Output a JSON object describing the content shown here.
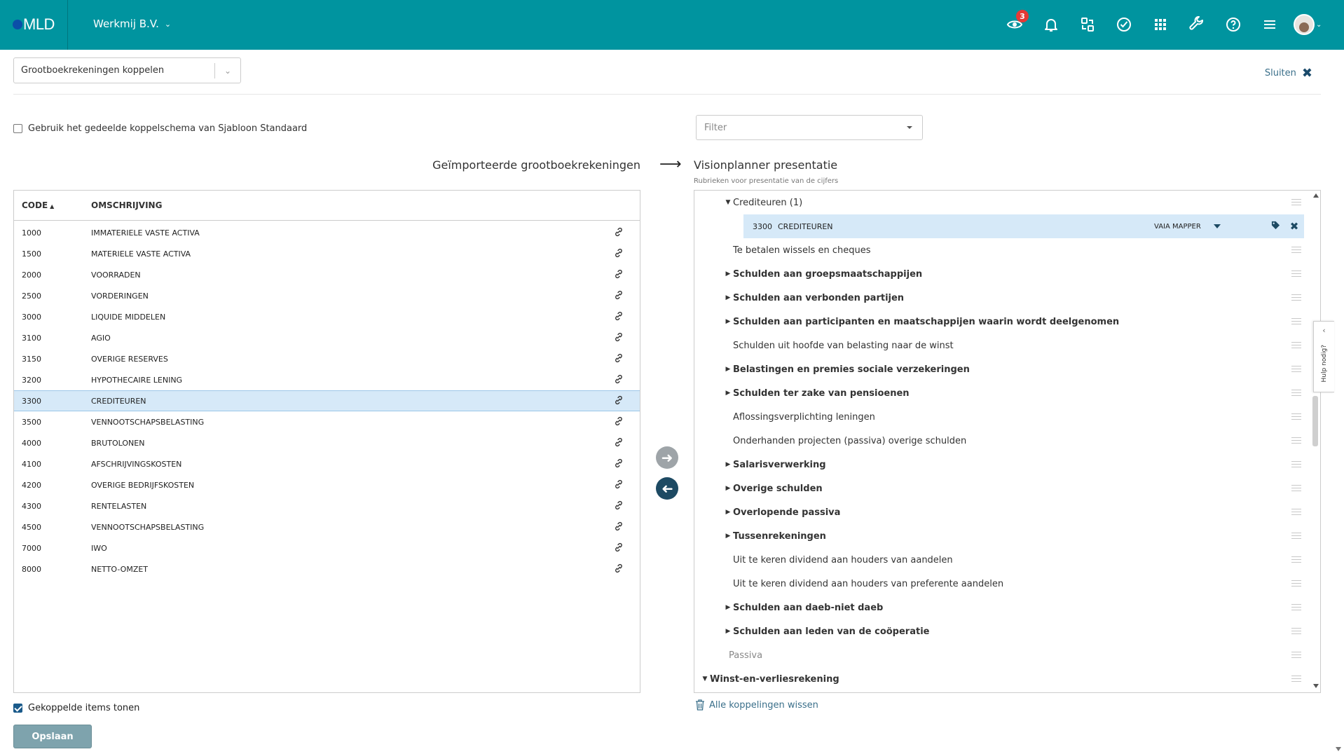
{
  "header": {
    "logo": "MLD",
    "company": "Werkmij B.V.",
    "notification_count": "3",
    "icons": [
      "visionplanner-eye-icon",
      "bell-icon",
      "transfer-icon",
      "check-circle-icon",
      "apps-grid-icon",
      "wrench-icon",
      "help-icon",
      "menu-icon"
    ],
    "accent": "#00949f"
  },
  "toolbar": {
    "mode_select": "Grootboekrekeningen koppelen",
    "close_label": "Sluiten"
  },
  "shared_schema": {
    "label": "Gebruik het gedeelde koppelschema van Sjabloon Standaard",
    "checked": false
  },
  "filter": {
    "placeholder": "Filter"
  },
  "left": {
    "title": "Geïmporteerde grootboekrekeningen",
    "columns": {
      "code": "CODE",
      "description": "OMSCHRIJVING"
    },
    "rows": [
      {
        "code": "1000",
        "desc": "IMMATERIELE VASTE ACTIVA"
      },
      {
        "code": "1500",
        "desc": "MATERIELE VASTE ACTIVA"
      },
      {
        "code": "2000",
        "desc": "VOORRADEN"
      },
      {
        "code": "2500",
        "desc": "VORDERINGEN"
      },
      {
        "code": "3000",
        "desc": "LIQUIDE MIDDELEN"
      },
      {
        "code": "3100",
        "desc": "AGIO"
      },
      {
        "code": "3150",
        "desc": "OVERIGE RESERVES"
      },
      {
        "code": "3200",
        "desc": "HYPOTHECAIRE LENING"
      },
      {
        "code": "3300",
        "desc": "CREDITEUREN"
      },
      {
        "code": "3500",
        "desc": "VENNOOTSCHAPSBELASTING"
      },
      {
        "code": "4000",
        "desc": "BRUTOLONEN"
      },
      {
        "code": "4100",
        "desc": "AFSCHRIJVINGSKOSTEN"
      },
      {
        "code": "4200",
        "desc": "OVERIGE BEDRIJFSKOSTEN"
      },
      {
        "code": "4300",
        "desc": "RENTELASTEN"
      },
      {
        "code": "4500",
        "desc": "VENNOOTSCHAPSBELASTING"
      },
      {
        "code": "7000",
        "desc": "IWO"
      },
      {
        "code": "8000",
        "desc": "NETTO-OMZET"
      }
    ],
    "selected_code": "3300"
  },
  "right": {
    "title": "Visionplanner presentatie",
    "subtitle": "Rubrieken voor presentatie van de cijfers",
    "tree": [
      {
        "label": "Crediteuren (1)",
        "bold": false,
        "state": "expanded",
        "level": 3
      },
      {
        "label": "",
        "kind": "mapped"
      },
      {
        "label": "Te betalen wissels en cheques",
        "bold": false,
        "state": "leaf",
        "level": 3
      },
      {
        "label": "Schulden aan groepsmaatschappijen",
        "bold": true,
        "state": "collapsed",
        "level": 3
      },
      {
        "label": "Schulden aan verbonden partijen",
        "bold": true,
        "state": "collapsed",
        "level": 3
      },
      {
        "label": "Schulden aan participanten en maatschappijen waarin wordt deelgenomen",
        "bold": true,
        "state": "collapsed",
        "level": 3
      },
      {
        "label": "Schulden uit hoofde van belasting naar de winst",
        "bold": false,
        "state": "leaf",
        "level": 3
      },
      {
        "label": "Belastingen en premies sociale verzekeringen",
        "bold": true,
        "state": "collapsed",
        "level": 3
      },
      {
        "label": "Schulden ter zake van pensioenen",
        "bold": true,
        "state": "collapsed",
        "level": 3
      },
      {
        "label": "Aflossingsverplichting leningen",
        "bold": false,
        "state": "leaf",
        "level": 3
      },
      {
        "label": "Onderhanden projecten (passiva) overige schulden",
        "bold": false,
        "state": "leaf",
        "level": 3
      },
      {
        "label": "Salarisverwerking",
        "bold": true,
        "state": "collapsed",
        "level": 3
      },
      {
        "label": "Overige schulden",
        "bold": true,
        "state": "collapsed",
        "level": 3
      },
      {
        "label": "Overlopende passiva",
        "bold": true,
        "state": "collapsed",
        "level": 3
      },
      {
        "label": "Tussenrekeningen",
        "bold": true,
        "state": "collapsed",
        "level": 3
      },
      {
        "label": "Uit te keren dividend aan houders van aandelen",
        "bold": false,
        "state": "leaf",
        "level": 3
      },
      {
        "label": "Uit te keren dividend aan houders van preferente aandelen",
        "bold": false,
        "state": "leaf",
        "level": 3
      },
      {
        "label": "Schulden aan daeb-niet daeb",
        "bold": true,
        "state": "collapsed",
        "level": 3
      },
      {
        "label": "Schulden aan leden van de coöperatie",
        "bold": true,
        "state": "collapsed",
        "level": 3
      },
      {
        "label": "Passiva",
        "bold": false,
        "state": "muted",
        "level": 2
      },
      {
        "label": "Winst-en-verliesrekening",
        "bold": true,
        "state": "expanded",
        "level": 1
      }
    ],
    "mapped_item": {
      "code": "3300",
      "desc": "CREDITEUREN",
      "mapper": "VAIA MAPPER"
    }
  },
  "help_tab": {
    "label": "Hulp nodig?"
  },
  "footer": {
    "show_linked_label": "Gekoppelde items tonen",
    "show_linked_checked": true,
    "clear_all_label": "Alle koppelingen wissen",
    "save_label": "Opslaan"
  }
}
